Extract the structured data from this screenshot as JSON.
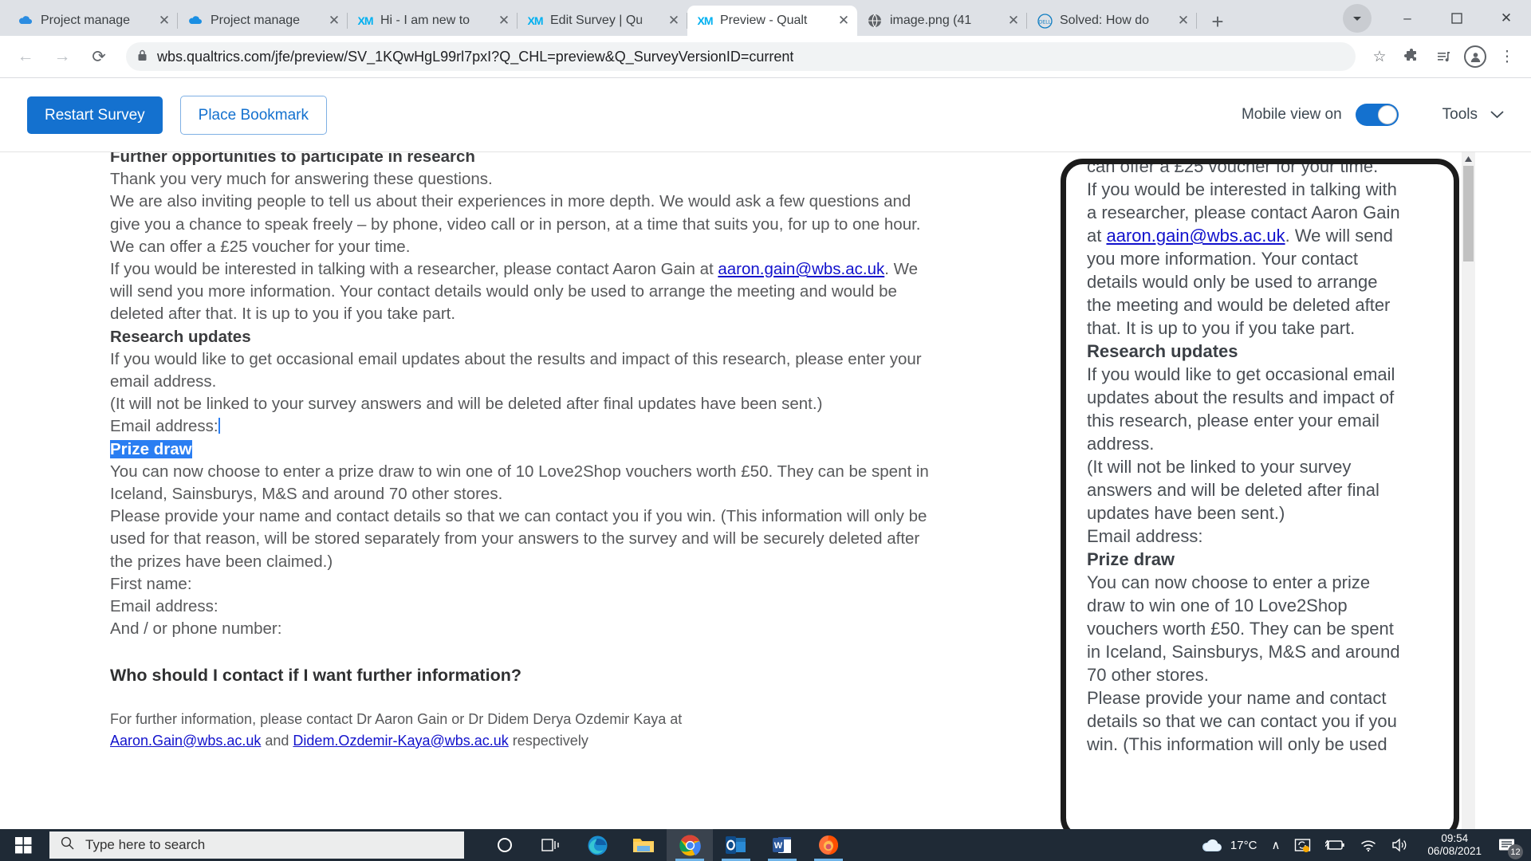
{
  "browser": {
    "tabs": [
      {
        "title": "Project manage",
        "favicon": "onedrive-icon",
        "active": false
      },
      {
        "title": "Project manage",
        "favicon": "onedrive-icon",
        "active": false
      },
      {
        "title": "Hi - I am new to",
        "favicon": "qualtrics-xm-icon",
        "active": false
      },
      {
        "title": "Edit Survey | Qu",
        "favicon": "qualtrics-xm-icon",
        "active": false
      },
      {
        "title": "Preview - Qualt",
        "favicon": "qualtrics-xm-icon",
        "active": true
      },
      {
        "title": "image.png (41",
        "favicon": "globe-icon",
        "active": false
      },
      {
        "title": "Solved: How do",
        "favicon": "dell-icon",
        "active": false
      }
    ],
    "new_tab_label": "+",
    "close_label": "✕",
    "window_controls": {
      "minimize": "–",
      "maximize": "☐",
      "close": "✕"
    },
    "toolbar": {
      "back": "←",
      "forward": "→",
      "reload": "⟳",
      "lock": "🔒",
      "url": "wbs.qualtrics.com/jfe/preview/SV_1KQwHgL99rl7pxI?Q_CHL=preview&Q_SurveyVersionID=current",
      "star": "☆",
      "extensions": "🧩",
      "media": "♫",
      "menu": "⋮"
    }
  },
  "qualtrics_bar": {
    "restart_label": "Restart Survey",
    "bookmark_label": "Place Bookmark",
    "mobile_view_label": "Mobile view on",
    "mobile_view_on": true,
    "tools_label": "Tools",
    "tools_chevron": "⌄",
    "accent_color": "#1471cf"
  },
  "survey": {
    "heading_cut": "Further opportunities to participate in research",
    "p_thanks": "Thank you very much for answering these questions.",
    "p_invite": "We are also inviting people to tell us about their experiences in more depth. We would ask a few questions and give you a chance to speak freely – by phone, video call or in person, at a time that suits you, for up to one hour. We can offer a £25 voucher for your time.",
    "p_contact_pre": "If you would be interested in talking with a researcher, please contact Aaron Gain at ",
    "researcher_email": "aaron.gain@wbs.ac.uk",
    "p_contact_post": ". We will send you more information. Your contact details would only be used to arrange the meeting and would be deleted after that. It is up to you if you take part.",
    "h_research_updates": "Research updates",
    "p_updates": "If you would like to get occasional email updates about the results and impact of this research, please enter your email address.",
    "p_updates_note": "(It will not be linked to your survey answers and will be deleted after final updates have been sent.)",
    "label_email_1": "Email address:",
    "h_prize_draw": "Prize draw",
    "p_prize_1": "You can now choose to enter a prize draw to win one of 10 Love2Shop vouchers worth £50. They can be spent in Iceland, Sainsburys, M&S and around 70 other stores.",
    "p_prize_2": "Please provide your name and contact details so that we can contact you if you win. (This information will only be used for that reason, will be stored separately from your answers to the survey and will be securely deleted after the prizes have been claimed.)",
    "label_first_name": "First name:",
    "label_email_2": "Email address:",
    "label_phone": "And / or phone number:",
    "h_contact": "Who should I contact if I want further information?",
    "p_further_pre": "For further information, please contact Dr Aaron Gain or Dr Didem Derya Ozdemir Kaya at ",
    "email_aaron": "Aaron.Gain@wbs.ac.uk",
    "p_further_and": " and ",
    "email_didem": "Didem.Ozdemir-Kaya@wbs.ac.uk",
    "p_further_post": " respectively"
  },
  "mobile_preview": {
    "p_voucher_tail": "can offer a £25 voucher for your time.",
    "p_contact_pre": "If you would be interested in talking with a researcher, please contact Aaron Gain at ",
    "researcher_email": "aaron.gain@wbs.ac.uk",
    "p_contact_post": ". We will send you more information. Your contact details would only be used to arrange the meeting and would be deleted after that. It is up to you if you take part.",
    "h_research_updates": "Research updates",
    "p_updates": "If you would like to get occasional email updates about the results and impact of this research, please enter your email address.",
    "p_updates_note": "(It will not be linked to your survey answers and will be deleted after final updates have been sent.)",
    "label_email_1": "Email address:",
    "h_prize_draw": "Prize draw",
    "p_prize_1": "You can now choose to enter a prize draw to win one of 10 Love2Shop vouchers worth £50. They can be spent in Iceland, Sainsburys, M&S and around 70 other stores.",
    "p_prize_2_partial": "Please provide your name and contact details so that we can contact you if you win. (This information will only be used"
  },
  "taskbar": {
    "start_label": "start-button",
    "search_placeholder": "Type here to search",
    "apps": [
      {
        "name": "cortana-icon"
      },
      {
        "name": "task-view-icon"
      },
      {
        "name": "edge-icon"
      },
      {
        "name": "file-explorer-icon"
      },
      {
        "name": "chrome-icon"
      },
      {
        "name": "outlook-icon"
      },
      {
        "name": "word-icon"
      },
      {
        "name": "firefox-icon"
      }
    ],
    "weather_temp": "17°C",
    "chevron_up": "∧",
    "time": "09:54",
    "date": "06/08/2021",
    "notification_count": "12"
  }
}
